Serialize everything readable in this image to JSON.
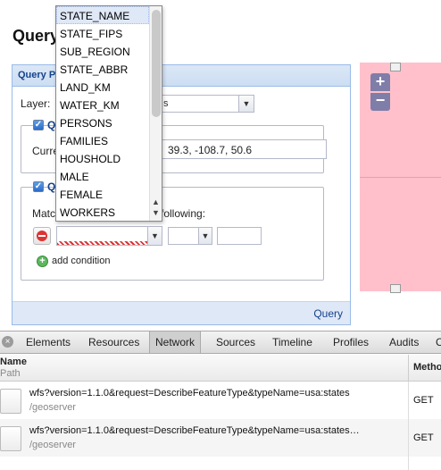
{
  "page": {
    "title": "Query"
  },
  "query_panel": {
    "title": "Query P",
    "layer_label": "Layer:",
    "layer_value": "s",
    "spatial_legend": "Q",
    "current_label": "Curre",
    "extent_value": "39.3, -108.7, 50.6",
    "attribute_legend": "Q",
    "match_label": "Matc",
    "match_following": "following:",
    "add_condition_label": "add condition",
    "query_button_label": "Query"
  },
  "attribute_dropdown": {
    "items": [
      "STATE_NAME",
      "STATE_FIPS",
      "SUB_REGION",
      "STATE_ABBR",
      "LAND_KM",
      "WATER_KM",
      "PERSONS",
      "FAMILIES",
      "HOUSHOLD",
      "MALE",
      "FEMALE",
      "WORKERS"
    ],
    "selected": "STATE_NAME"
  },
  "map": {
    "zoom_in": "+",
    "zoom_out": "−",
    "background_color": "#ffc0cb"
  },
  "devtools": {
    "close": "×",
    "tabs": [
      "Elements",
      "Resources",
      "Network",
      "Sources",
      "Timeline",
      "Profiles",
      "Audits",
      "C"
    ],
    "active_tab": "Network",
    "columns": {
      "name": "Name",
      "path": "Path",
      "method": "Method"
    },
    "requests": [
      {
        "name": "wfs?version=1.1.0&request=DescribeFeatureType&typeName=usa:states",
        "path": "/geoserver",
        "method": "GET"
      },
      {
        "name": "wfs?version=1.1.0&request=DescribeFeatureType&typeName=usa:states…",
        "path": "/geoserver",
        "method": "GET"
      }
    ]
  }
}
